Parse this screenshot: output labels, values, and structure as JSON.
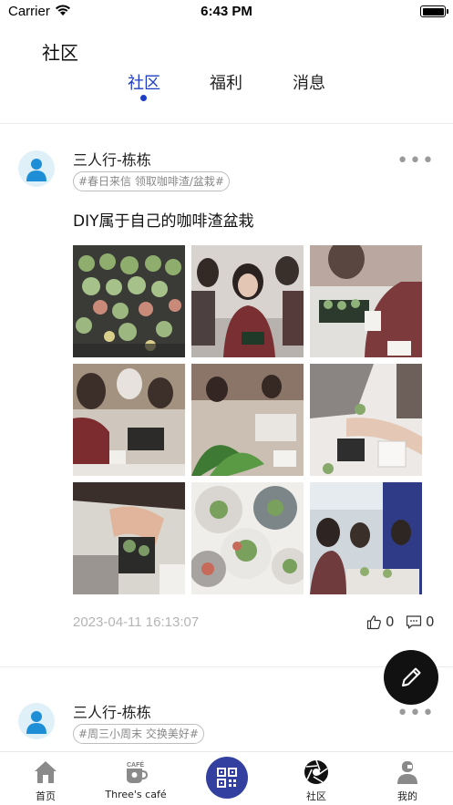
{
  "status_bar": {
    "carrier": "Carrier",
    "time": "6:43 PM"
  },
  "header": {
    "title": "社区"
  },
  "tabs": [
    {
      "label": "社区",
      "active": true
    },
    {
      "label": "福利",
      "active": false
    },
    {
      "label": "消息",
      "active": false
    }
  ],
  "posts": [
    {
      "author": "三人行-栋栋",
      "tag": "#春日来信 领取咖啡渣/盆栽#",
      "title": "DIY属于自己的咖啡渣盆栽",
      "photo_count": 9,
      "timestamp": "2023-04-11 16:13:07",
      "likes": "0",
      "comments": "0"
    },
    {
      "author": "三人行-栋栋",
      "tag": "#周三小周末 交换美好#"
    }
  ],
  "tabbar": {
    "items": [
      {
        "label": "首页",
        "icon": "home-icon"
      },
      {
        "label": "Three's café",
        "icon": "cafe-cup-icon"
      },
      {
        "label": "",
        "icon": "qr-code-icon"
      },
      {
        "label": "社区",
        "icon": "aperture-icon"
      },
      {
        "label": "我的",
        "icon": "profile-icon"
      }
    ]
  },
  "colors": {
    "accent": "#1f3dc4",
    "qr_button": "#3340a0",
    "fab": "#111111"
  }
}
